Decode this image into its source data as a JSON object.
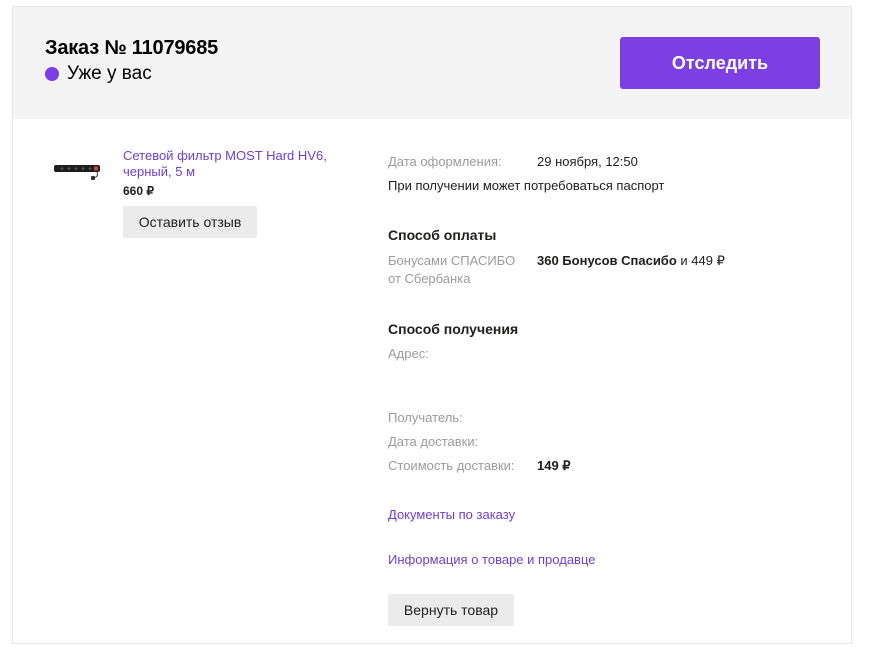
{
  "order": {
    "title": "Заказ № 11079685",
    "status": "Уже у вас",
    "track_label": "Отследить",
    "status_color": "#7b3fe4"
  },
  "product": {
    "name": "Сетевой фильтр MOST Hard HV6, черный, 5 м",
    "price": "660 ₽",
    "review_label": "Оставить отзыв"
  },
  "details": {
    "date_label": "Дата оформления:",
    "date_value": "29 ноября, 12:50",
    "passport_note": "При получении может потребоваться паспорт",
    "payment_title": "Способ оплаты",
    "payment_label": "Бонусами СПАСИБО от Сбербанка",
    "payment_bonus": "360 Бонусов Спасибо",
    "payment_and": " и ",
    "payment_rest": "449 ₽",
    "delivery_title": "Способ получения",
    "address_label": "Адрес:",
    "recipient_label": "Получатель:",
    "delivery_date_label": "Дата доставки:",
    "delivery_cost_label": "Стоимость доставки:",
    "delivery_cost_value": "149 ₽",
    "docs_link": "Документы по заказу",
    "info_link": "Информация о товаре и продавце",
    "return_label": "Вернуть товар"
  }
}
